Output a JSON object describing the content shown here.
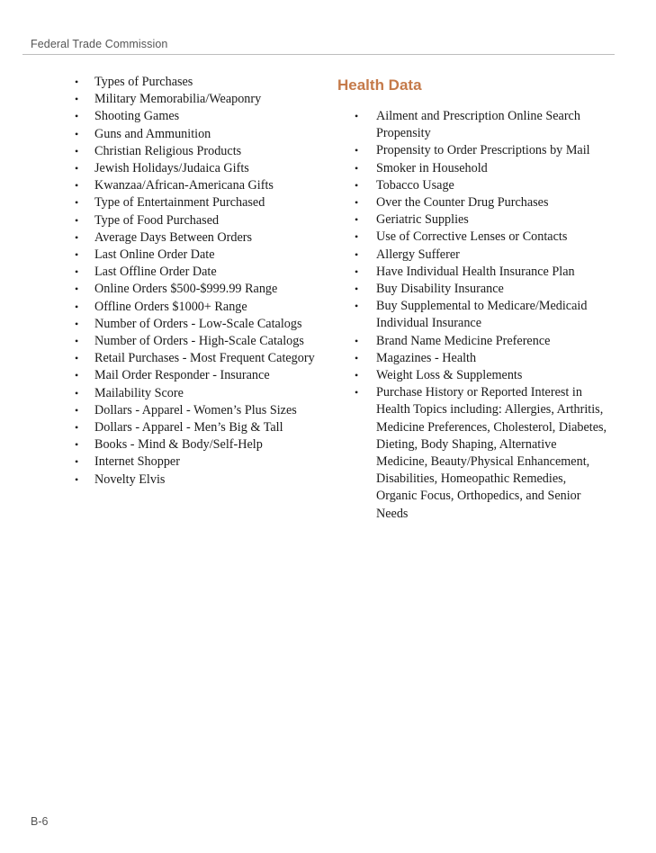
{
  "header": {
    "running_title": "Federal Trade Commission"
  },
  "left_column": {
    "items": [
      "Types of Purchases",
      "Military Memorabilia/Weaponry",
      "Shooting Games",
      "Guns and Ammunition",
      "Christian Religious Products",
      "Jewish Holidays/Judaica Gifts",
      "Kwanzaa/African-Americana Gifts",
      "Type of Entertainment Purchased",
      "Type of Food Purchased",
      "Average Days Between Orders",
      "Last Online Order Date",
      "Last Offline Order Date",
      "Online Orders $500-$999.99 Range",
      "Offline Orders $1000+ Range",
      "Number of Orders - Low-Scale Catalogs",
      "Number of Orders - High-Scale Catalogs",
      "Retail Purchases - Most Frequent Category",
      "Mail Order Responder - Insurance",
      "Mailability Score",
      "Dollars - Apparel - Women’s Plus Sizes",
      "Dollars - Apparel - Men’s Big & Tall",
      "Books - Mind & Body/Self-Help",
      "Internet Shopper",
      "Novelty Elvis"
    ]
  },
  "right_column": {
    "heading": "Health Data",
    "heading_color": "#c57a4a",
    "items": [
      "Ailment and Prescription Online Search Propensity",
      "Propensity to Order Prescriptions by Mail",
      "Smoker in Household",
      "Tobacco Usage",
      "Over the Counter Drug Purchases",
      "Geriatric Supplies",
      "Use of Corrective Lenses or Contacts",
      "Allergy Sufferer",
      "Have Individual Health Insurance Plan",
      "Buy Disability Insurance",
      "Buy Supplemental to Medicare/Medicaid Individual Insurance",
      "Brand Name Medicine Preference",
      "Magazines - Health",
      "Weight Loss & Supplements",
      "Purchase History or Reported Interest in Health Topics including: Allergies, Arthritis, Medicine Preferences, Cholesterol, Diabetes, Dieting, Body Shaping, Alternative Medicine, Beauty/Physical Enhancement, Disabilities, Homeopathic Remedies, Organic Focus, Orthopedics, and Senior Needs"
    ]
  },
  "footer": {
    "page_number": "B-6"
  },
  "bullet_glyph": "•"
}
